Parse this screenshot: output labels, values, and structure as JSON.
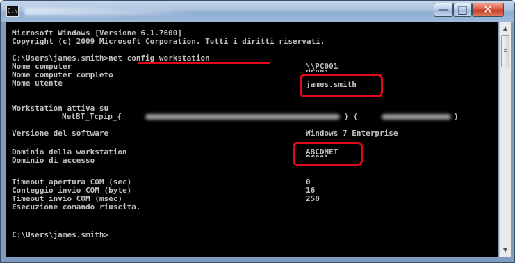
{
  "window": {
    "icon_text": "C:\\",
    "controls": {
      "minimize": "—",
      "maximize": "□",
      "close": "✕"
    }
  },
  "console": {
    "header": [
      "Microsoft Windows [Versione 6.1.7600]",
      "Copyright (c) 2009 Microsoft Corporation. Tutti i diritti riservati."
    ],
    "prompt": "C:\\Users\\james.smith>",
    "command": "net config workstation",
    "computer_name_label": "Nome computer",
    "computer_name_value": "\\\\PC001",
    "full_computer_name_label": "Nome computer completo",
    "full_computer_name_value": "PC001",
    "user_name_label": "Nome utente",
    "user_name_value": "james.smith",
    "active_on_label": "Workstation attiva su",
    "active_on_value": "NetBT_Tcpip_{",
    "active_on_suffix": ") (",
    "active_on_end": ")",
    "software_label": "Versione del software",
    "software_value": "Windows 7 Enterprise",
    "domain_label": "Dominio della workstation",
    "domain_value": "ABCDNET",
    "logon_domain_label": "Dominio di accesso",
    "logon_domain_value": "PC001",
    "com_open_label": "Timeout apertura COM (sec)",
    "com_open_value": "0",
    "com_send_count_label": "Conteggio invio COM (byte)",
    "com_send_count_value": "16",
    "com_send_timeout_label": "Timeout invio COM (msec)",
    "com_send_timeout_value": "250",
    "success_message": "Esecuzione comando riuscita.",
    "final_prompt": "C:\\Users\\james.smith>"
  },
  "highlight_color": "#e3071a",
  "scrollbar": {
    "up_arrow": "▲",
    "down_arrow": "▼"
  }
}
